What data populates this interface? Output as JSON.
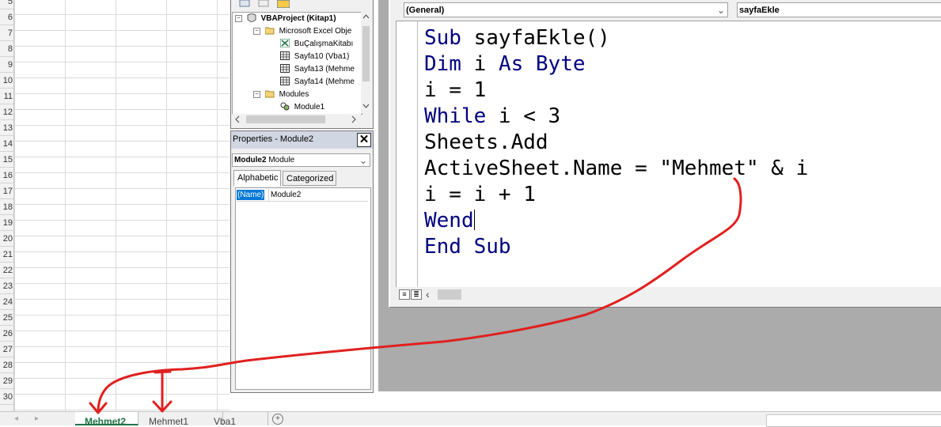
{
  "sheet": {
    "row_numbers": [
      "5",
      "6",
      "7",
      "8",
      "9",
      "10",
      "11",
      "12",
      "13",
      "14",
      "15",
      "16",
      "17",
      "18",
      "19",
      "20",
      "21",
      "22",
      "23",
      "24",
      "25",
      "26",
      "27",
      "28",
      "29",
      "30"
    ]
  },
  "project": {
    "root": "VBAProject (Kitap1)",
    "excel_objects_folder": "Microsoft Excel Obje",
    "items": [
      "BuÇalışmaKitabı",
      "Sayfa10 (Vba1)",
      "Sayfa13 (Mehme",
      "Sayfa14 (Mehme"
    ],
    "modules_folder": "Modules",
    "module1": "Module1"
  },
  "properties": {
    "title": "Properties - Module2",
    "close_glyph": "✕",
    "object_name": "Module2",
    "object_type": "Module",
    "tabs": [
      "Alphabetic",
      "Categorized"
    ],
    "row_name": "(Name)",
    "row_value": "Module2"
  },
  "code": {
    "object_combo": "(General)",
    "procedure_combo": "sayfaEkle",
    "lines": {
      "l1_kw": "Sub ",
      "l1_tx": "sayfaEkle()",
      "l2_kw1": "Dim ",
      "l2_tx": "i ",
      "l2_kw2": "As Byte",
      "l3": "i = 1",
      "l4_kw": "While ",
      "l4_tx": "i < 3",
      "l5": "Sheets.Add",
      "l6": "ActiveSheet.Name = \"Mehmet\" & i",
      "l7": "i = i + 1",
      "l8_kw": "Wend",
      "l9_kw": "End Sub"
    }
  },
  "tabs": {
    "sheets": [
      "Mehmet2",
      "Mehmet1",
      "Vba1"
    ],
    "active": "Mehmet2",
    "add_glyph": "+"
  },
  "colors": {
    "keyword": "#00007f",
    "annotation": "#e02020",
    "active_tab": "#217346"
  }
}
